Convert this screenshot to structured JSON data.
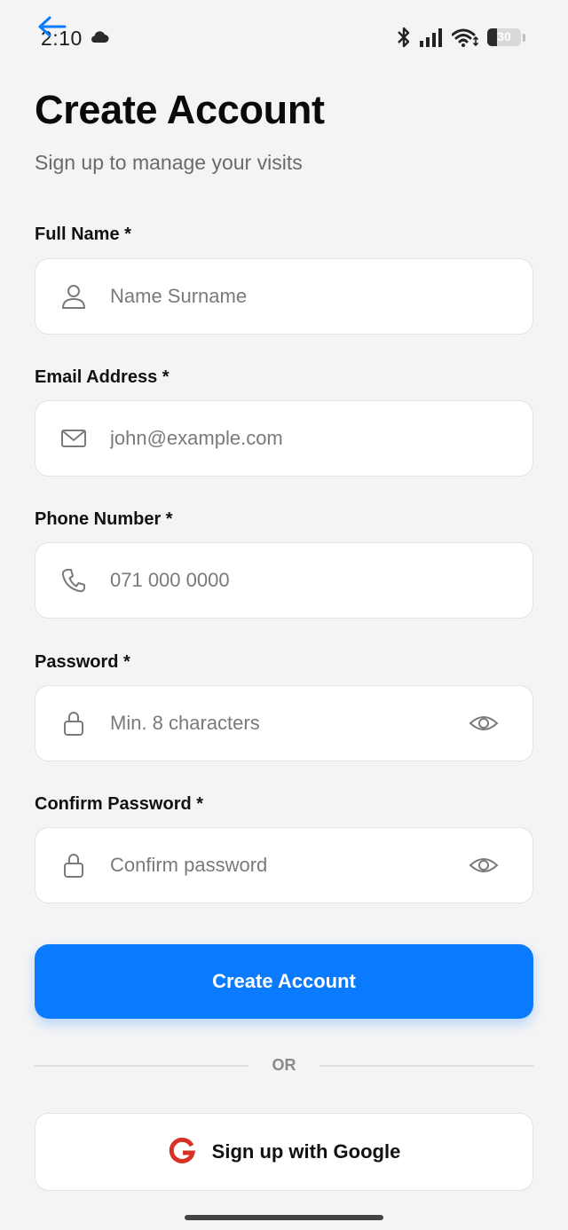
{
  "status_bar": {
    "time": "2:10",
    "battery_level": "30",
    "battery_fraction": 0.3
  },
  "header": {
    "title": "Create Account",
    "subtitle": "Sign up to manage your visits"
  },
  "fields": {
    "full_name": {
      "label": "Full Name *",
      "placeholder": "Name Surname",
      "value": "",
      "icon": "user-icon"
    },
    "email": {
      "label": "Email Address *",
      "placeholder": "john@example.com",
      "value": "",
      "icon": "mail-icon"
    },
    "phone": {
      "label": "Phone Number *",
      "placeholder": "071 000 0000",
      "value": "",
      "icon": "phone-icon"
    },
    "password": {
      "label": "Password *",
      "placeholder": "Min. 8 characters",
      "value": "",
      "icon": "lock-icon"
    },
    "confirm_password": {
      "label": "Confirm Password *",
      "placeholder": "Confirm password",
      "value": "",
      "icon": "lock-icon"
    }
  },
  "actions": {
    "create_account_label": "Create Account",
    "divider_label": "OR",
    "google_label": "Sign up with Google"
  },
  "colors": {
    "accent": "#0a7aff",
    "background": "#f4f4f5",
    "google_red": "#d93025"
  }
}
